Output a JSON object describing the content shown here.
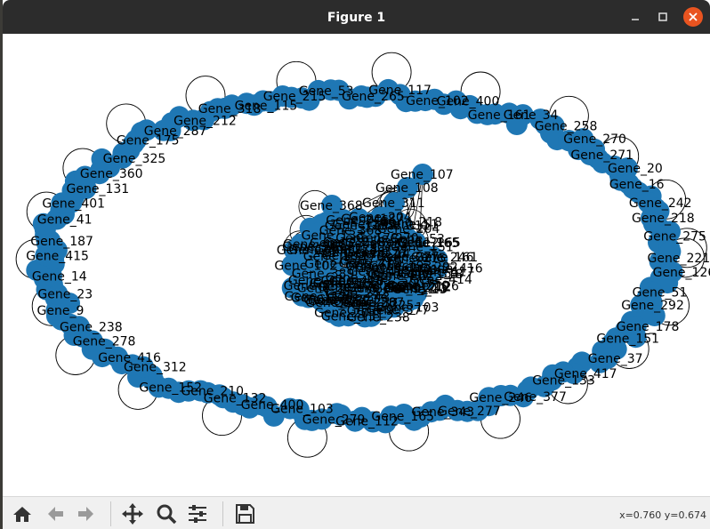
{
  "window": {
    "title": "Figure 1"
  },
  "toolbar": {
    "buttons": [
      "home-icon",
      "back-icon",
      "forward-icon",
      "pan-icon",
      "zoom-icon",
      "configure-subplots-icon",
      "save-icon"
    ],
    "coords": "x=0.760 y=0.674"
  },
  "colors": {
    "node": "#1f77b4",
    "edge": "#000000",
    "titlebar": "#2c2c2c",
    "close": "#e95420"
  },
  "graph": {
    "labels": [
      {
        "t": "Gene_221"
      },
      {
        "t": "Gene_126"
      },
      {
        "t": "Gene_51"
      },
      {
        "t": "Gene_292"
      },
      {
        "t": "Gene_178"
      },
      {
        "t": "Gene_151"
      },
      {
        "t": "Gene_37"
      },
      {
        "t": "Gene_417"
      },
      {
        "t": "Gene_133"
      },
      {
        "t": "Gene_377"
      },
      {
        "t": "Gene_246"
      },
      {
        "t": "Gene_277"
      },
      {
        "t": "Gene_343"
      },
      {
        "t": "Gene_165"
      },
      {
        "t": "Gene_112"
      },
      {
        "t": "Gene_279"
      },
      {
        "t": "Gene_103"
      },
      {
        "t": "Gene_400"
      },
      {
        "t": "Gene_132"
      },
      {
        "t": "Gene_210"
      },
      {
        "t": "Gene_152"
      },
      {
        "t": "Gene_312"
      },
      {
        "t": "Gene_416"
      },
      {
        "t": "Gene_278"
      },
      {
        "t": "Gene_238"
      },
      {
        "t": "Gene_9"
      },
      {
        "t": "Gene_23"
      },
      {
        "t": "Gene_14"
      },
      {
        "t": "Gene_415"
      },
      {
        "t": "Gene_187"
      },
      {
        "t": "Gene_41"
      },
      {
        "t": "Gene_401"
      },
      {
        "t": "Gene_131"
      },
      {
        "t": "Gene_360"
      },
      {
        "t": "Gene_325"
      },
      {
        "t": "Gene_175"
      },
      {
        "t": "Gene_287"
      },
      {
        "t": "Gene_212"
      },
      {
        "t": "Gene_318"
      },
      {
        "t": "Gene_115"
      },
      {
        "t": "Gene_215"
      },
      {
        "t": "Gene_53"
      },
      {
        "t": "Gene_265"
      },
      {
        "t": "Gene_117"
      },
      {
        "t": "Gene_102"
      },
      {
        "t": "Gene_400"
      },
      {
        "t": "Gene_161"
      },
      {
        "t": "Gene_34"
      },
      {
        "t": "Gene_258"
      },
      {
        "t": "Gene_270"
      },
      {
        "t": "Gene_271"
      },
      {
        "t": "Gene_20"
      },
      {
        "t": "Gene_16"
      },
      {
        "t": "Gene_242"
      },
      {
        "t": "Gene_218"
      },
      {
        "t": "Gene_275"
      },
      {
        "t": "Gene_211"
      },
      {
        "t": "Gene_107"
      },
      {
        "t": "Gene_108"
      },
      {
        "t": "Gene_311"
      },
      {
        "t": "Gene_204"
      },
      {
        "t": "Gene_368"
      },
      {
        "t": "Gene_414"
      },
      {
        "t": "Gene_193"
      },
      {
        "t": "Gene_389"
      },
      {
        "t": "Gene_418"
      },
      {
        "t": "Gene_176"
      },
      {
        "t": "Gene_389"
      },
      {
        "t": "Gene_300"
      },
      {
        "t": "Gene_250"
      },
      {
        "t": "Gene_283"
      },
      {
        "t": "Gene_307"
      },
      {
        "t": "Gene_262"
      },
      {
        "t": "Gene_13"
      }
    ]
  }
}
